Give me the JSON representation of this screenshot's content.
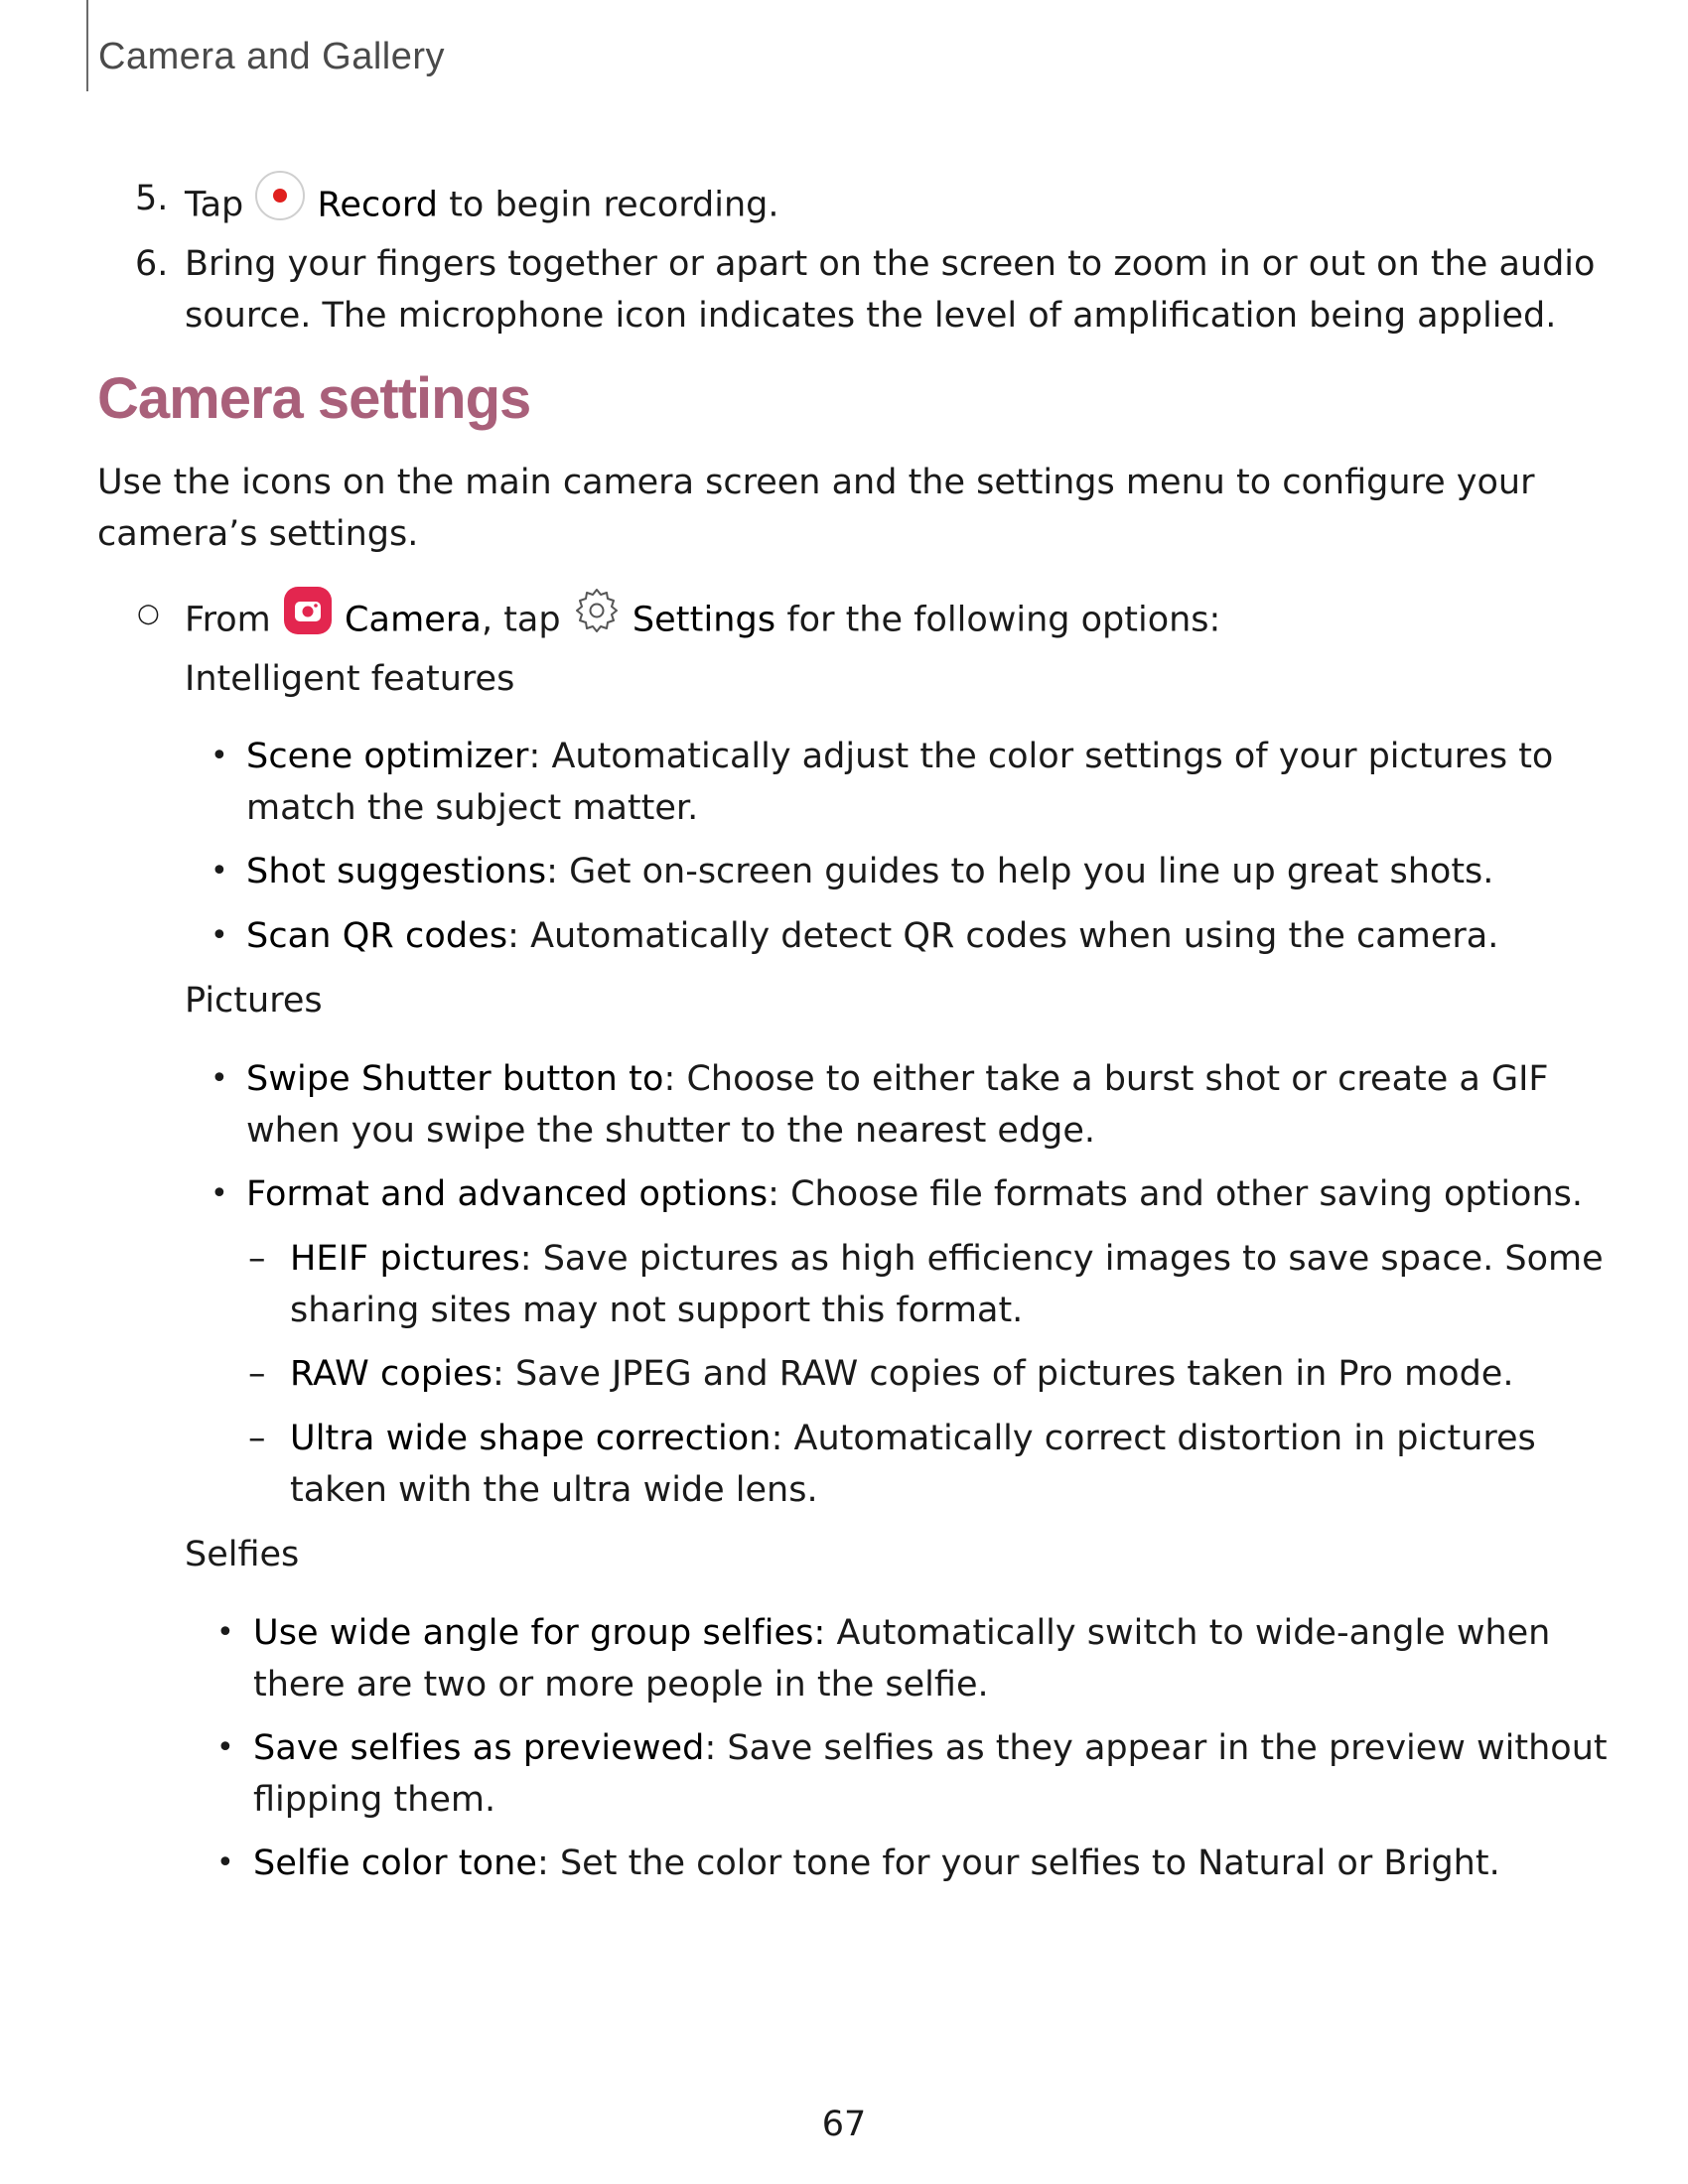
{
  "header": {
    "title": "Camera and Gallery"
  },
  "steps": [
    {
      "number": "5.",
      "lines": [
        {
          "pre": "Tap ",
          "bold": "Record",
          "post": " to begin recording."
        }
      ]
    },
    {
      "number": "6.",
      "lines": [
        "Bring your fingers together or apart on the screen to zoom in or out on the audio",
        "source. The microphone icon indicates the level of amplification being applied."
      ]
    }
  ],
  "section": {
    "title": "Camera settings",
    "intro_lines": [
      "Use the icons on the main camera screen and the settings menu to configure your",
      "camera’s settings."
    ]
  },
  "from_line": {
    "pre": "From ",
    "camera": "Camera",
    "mid": ", tap ",
    "settings": "Settings",
    "post": " for the following options:"
  },
  "groups": {
    "intelligent": {
      "heading": "Intelligent features",
      "items": [
        {
          "bold": "Scene optimizer",
          "text1": ": Automatically adjust the color settings of your pictures to",
          "text2": "match the subject matter."
        },
        {
          "bold": "Shot suggestions",
          "text1": ": Get on-screen guides to help you line up great shots."
        },
        {
          "bold": "Scan QR codes",
          "text1": ": Automatically detect QR codes when using the camera."
        }
      ]
    },
    "pictures": {
      "heading": "Pictures",
      "items": [
        {
          "bold": "Swipe Shutter button to",
          "text1": ": Choose to either take a burst shot or create a GIF",
          "text2": "when you swipe the shutter to the nearest edge."
        },
        {
          "bold": "Format and advanced options",
          "text1": ": Choose file formats and other saving options."
        }
      ],
      "subitems": [
        {
          "bold": "HEIF pictures",
          "text1": ": Save pictures as high efficiency images to save space. Some",
          "text2": "sharing sites may not support this format."
        },
        {
          "bold": "RAW copies",
          "text1": ": Save JPEG and RAW copies of pictures taken in Pro mode."
        },
        {
          "bold": "Ultra wide shape correction",
          "text1": ": Automatically correct distortion in pictures",
          "text2": "taken with the ultra wide lens."
        }
      ]
    },
    "selfies": {
      "heading": "Selfies",
      "items": [
        {
          "bold": "Use wide angle for group selfies:",
          "text1": " Automatically switch to wide-angle when",
          "text2": "there are two or more people in the selfie."
        },
        {
          "bold": "Save selfies as previewed",
          "text1": ": Save selfies as they appear in the preview without",
          "text2": "flipping them."
        },
        {
          "bold": "Selfie color tone",
          "text1": ": Set the color tone for your selfies to Natural or Bright."
        }
      ]
    }
  },
  "glyphs": {
    "bullet": "•",
    "dash": "–",
    "circle": "○"
  },
  "colors": {
    "accent": "#a9607a",
    "record": "#e0201e",
    "camera_icon": "#e3264f"
  },
  "footer": {
    "page_number": "67"
  }
}
